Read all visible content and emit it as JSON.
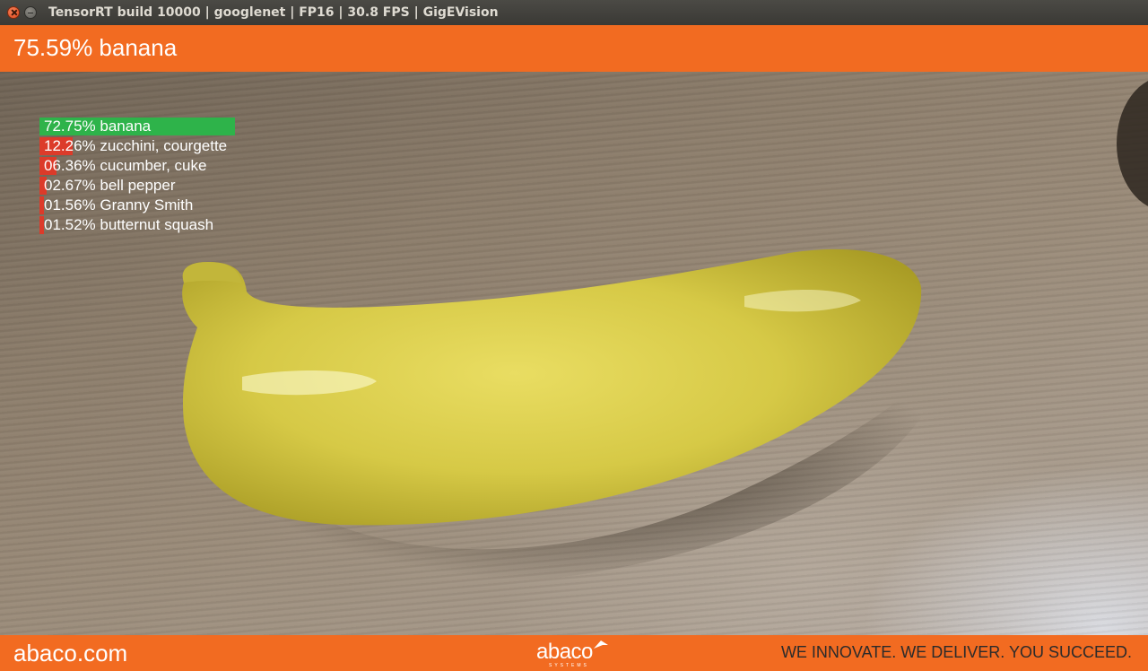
{
  "window": {
    "title": "TensorRT build 10000 | googlenet | FP16 | 30.8 FPS | GigEVision"
  },
  "header": {
    "top_result": "75.59% banana"
  },
  "classifications": [
    {
      "label": "72.75% banana",
      "probability": 0.7275,
      "color": "#2eb34a"
    },
    {
      "label": "12.26% zucchini, courgette",
      "probability": 0.1226,
      "color": "#dc3b2a"
    },
    {
      "label": "06.36% cucumber, cuke",
      "probability": 0.0636,
      "color": "#dc3b2a"
    },
    {
      "label": "02.67% bell pepper",
      "probability": 0.0267,
      "color": "#dc3b2a"
    },
    {
      "label": "01.56% Granny Smith",
      "probability": 0.0156,
      "color": "#dc3b2a"
    },
    {
      "label": "01.52% butternut squash",
      "probability": 0.0152,
      "color": "#dc3b2a"
    }
  ],
  "footer": {
    "website": "abaco.com",
    "logo_text": "abaco",
    "logo_subtext": "SYSTEMS",
    "slogan": "WE INNOVATE. WE DELIVER. YOU SUCCEED."
  },
  "colors": {
    "brand_orange": "#f26b21",
    "title_bar": "#3c3b37"
  },
  "icons": {
    "close": "close-icon",
    "minimize": "minimize-icon"
  }
}
